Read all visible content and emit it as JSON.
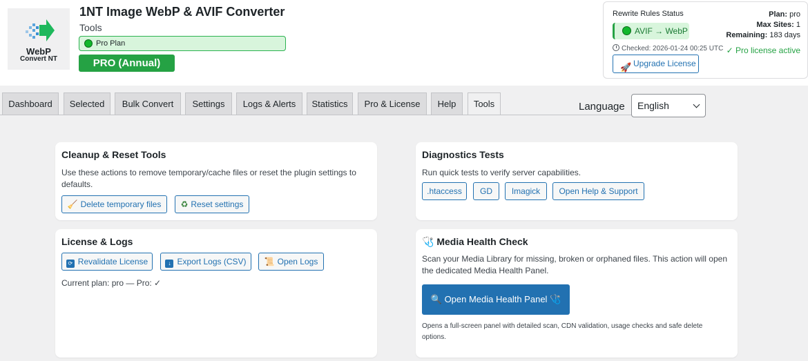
{
  "header": {
    "logo_line1": "WebP",
    "logo_line2": "Convert NT",
    "title": "1NT Image WebP & AVIF Converter",
    "subtitle": "Tools",
    "plan_badge": "Pro Plan",
    "plan_type": "PRO (Annual)"
  },
  "rewrite": {
    "title": "Rewrite Rules Status",
    "status": "AVIF → WebP",
    "checked": "Checked: 2026-01-24 00:25 UTC",
    "upgrade_label": "Upgrade License",
    "plan_label": "Plan:",
    "plan_value": "pro",
    "max_sites_label": "Max Sites:",
    "max_sites_value": "1",
    "remaining_label": "Remaining:",
    "remaining_value": "183 days",
    "license_active": "✓ Pro license active"
  },
  "tabs": [
    {
      "label": "Dashboard"
    },
    {
      "label": "Selected"
    },
    {
      "label": "Bulk Convert"
    },
    {
      "label": "Settings"
    },
    {
      "label": "Logs & Alerts"
    },
    {
      "label": "Statistics"
    },
    {
      "label": "Pro & License"
    },
    {
      "label": "Help"
    },
    {
      "label": "Tools"
    }
  ],
  "active_tab": "Tools",
  "language": {
    "label": "Language",
    "selected": "English"
  },
  "cleanup": {
    "title": "Cleanup & Reset Tools",
    "description": "Use these actions to remove temporary/cache files or reset the plugin settings to defaults.",
    "delete_label": "Delete temporary files",
    "reset_label": "Reset settings"
  },
  "diagnostics": {
    "title": "Diagnostics Tests",
    "description": "Run quick tests to verify server capabilities.",
    "htaccess_label": ".htaccess",
    "gd_label": "GD",
    "imagick_label": "Imagick",
    "help_label": "Open Help & Support"
  },
  "license_logs": {
    "title": "License & Logs",
    "revalidate_label": "Revalidate License",
    "export_label": "Export Logs (CSV)",
    "open_logs_label": "Open Logs",
    "current_plan": "Current plan: pro — Pro: ✓"
  },
  "media_health": {
    "title": "Media Health Check",
    "description": "Scan your Media Library for missing, broken or orphaned files. This action will open the dedicated Media Health Panel.",
    "button_label": "Open Media Health Panel",
    "note": "Opens a full-screen panel with detailed scan, CDN validation, usage checks and safe delete options."
  },
  "colors": {
    "accent": "#2271b1",
    "success": "#25a244",
    "success_bg": "#d8f5dc"
  },
  "icons": {
    "logo": "arrow-logo-icon",
    "broom": "broom-icon",
    "recycle": "recycle-icon",
    "refresh": "refresh-icon",
    "download": "download-icon",
    "scroll": "scroll-icon",
    "stethoscope": "stethoscope-icon",
    "magnifier": "magnifier-icon",
    "rocket": "rocket-icon",
    "clock": "clock-icon"
  }
}
